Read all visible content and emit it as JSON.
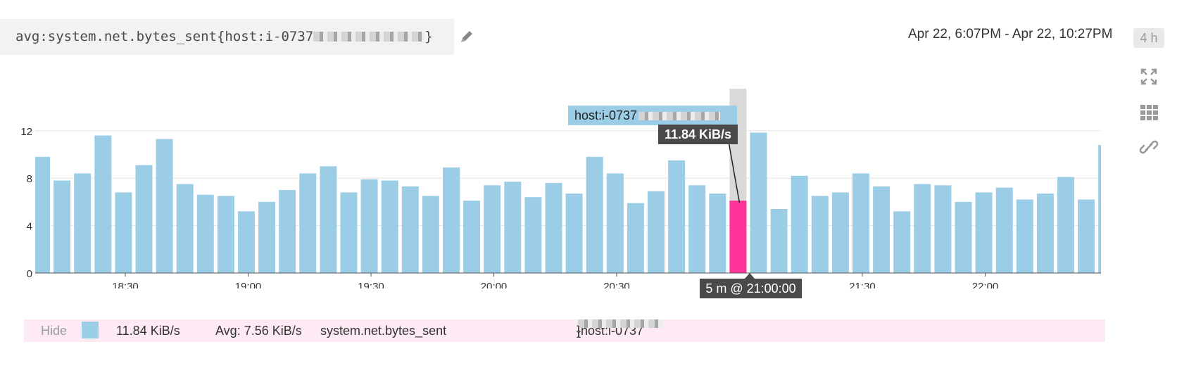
{
  "header": {
    "query_prefix": "avg:system.net.bytes_sent{host:i-0737",
    "query_suffix": "}",
    "timerange": "Apr 22, 6:07PM - Apr 22, 10:27PM",
    "span": "4 h"
  },
  "icons": {
    "edit": "pencil-icon",
    "expand": "expand-icon",
    "grid": "grid-icon",
    "link": "link-icon"
  },
  "colors": {
    "bar": "#9ccde6",
    "highlight": "#ff3399",
    "highlight_bg": "#d9d9d9",
    "legend_bg": "#fdeaf4",
    "tooltip_bg": "#4a4a4a"
  },
  "tooltip": {
    "host_label": "host:i-0737",
    "value": "11.84 KiB/s",
    "time": "5 m @ 21:00:00"
  },
  "legend": {
    "hide_label": "Hide",
    "value": "11.84 KiB/s",
    "avg": "Avg: 7.56 KiB/s",
    "metric": "system.net.bytes_sent",
    "host_prefix": "{host:i-0737",
    "host_suffix": "}"
  },
  "chart_data": {
    "type": "bar",
    "unit": "KiB/s",
    "interval": "5 m",
    "ylim": [
      0,
      14
    ],
    "yticks": [
      0,
      4,
      8,
      12
    ],
    "xticks": [
      "18:30",
      "19:00",
      "19:30",
      "20:00",
      "20:30",
      "21:00",
      "21:30",
      "22:00"
    ],
    "highlight_index": 34,
    "series": [
      {
        "values": [
          9.8,
          7.8,
          8.4,
          11.6,
          6.8,
          9.1,
          11.3,
          7.5,
          6.6,
          6.5,
          5.2,
          6.0,
          7.0,
          8.4,
          9.0,
          6.8,
          7.9,
          7.8,
          7.3,
          6.5,
          8.9,
          6.1,
          7.4,
          7.7,
          6.4,
          7.6,
          6.7,
          9.8,
          8.4,
          5.9,
          6.9,
          9.5,
          7.4,
          6.7,
          6.1,
          11.84,
          5.4,
          8.2,
          6.5,
          6.8,
          8.4,
          7.3,
          5.2,
          7.5,
          7.4,
          6.0,
          6.8,
          7.2,
          6.2,
          6.7,
          8.1,
          6.2,
          10.8
        ]
      }
    ]
  }
}
